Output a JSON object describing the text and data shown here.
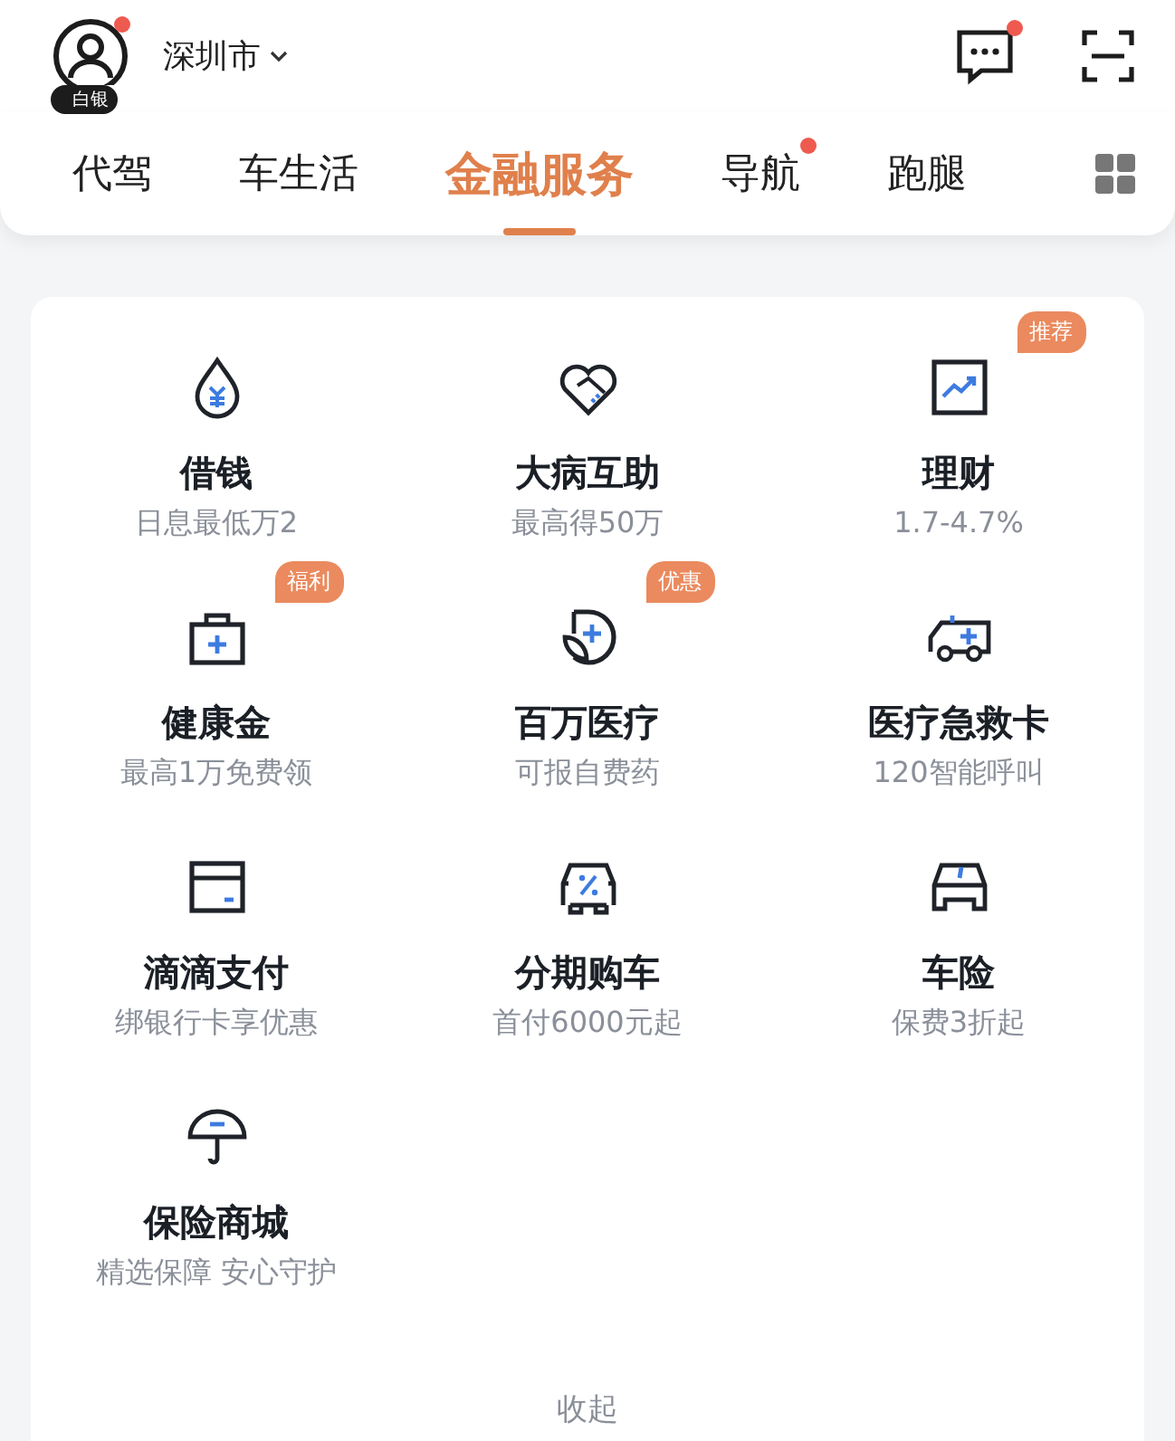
{
  "header": {
    "avatar_badge": "白银",
    "avatar_dot": true,
    "city": "深圳市",
    "message_dot": true
  },
  "tabs": [
    {
      "label": "代驾",
      "selected": false,
      "dot": false
    },
    {
      "label": "车生活",
      "selected": false,
      "dot": false
    },
    {
      "label": "金融服务",
      "selected": true,
      "dot": false
    },
    {
      "label": "导航",
      "selected": false,
      "dot": true
    },
    {
      "label": "跑腿",
      "selected": false,
      "dot": false
    }
  ],
  "services": [
    {
      "name": "借钱",
      "sub": "日息最低万2"
    },
    {
      "name": "大病互助",
      "sub": "最高得50万"
    },
    {
      "name": "理财",
      "sub": "1.7-4.7%",
      "badge": "推荐"
    },
    {
      "name": "健康金",
      "sub": "最高1万免费领",
      "badge": "福利"
    },
    {
      "name": "百万医疗",
      "sub": "可报自费药",
      "badge": "优惠"
    },
    {
      "name": "医疗急救卡",
      "sub": "120智能呼叫"
    },
    {
      "name": "滴滴支付",
      "sub": "绑银行卡享优惠"
    },
    {
      "name": "分期购车",
      "sub": "首付6000元起"
    },
    {
      "name": "车险",
      "sub": "保费3折起"
    },
    {
      "name": "保险商城",
      "sub": "精选保障 安心守护"
    }
  ],
  "collapse": "收起"
}
